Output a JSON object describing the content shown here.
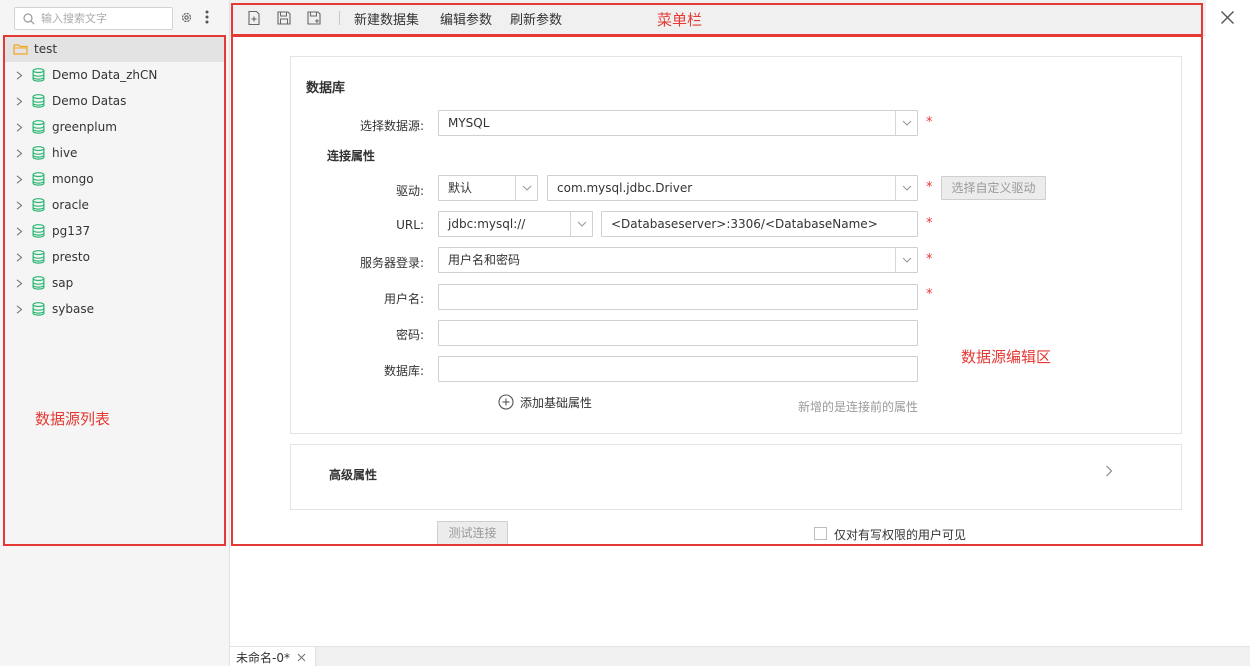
{
  "sidebar": {
    "search_placeholder": "输入搜索文字",
    "root": {
      "label": "test",
      "icon": "folder-icon"
    },
    "items": [
      {
        "label": "Demo Data_zhCN",
        "icon": "database-icon"
      },
      {
        "label": "Demo Datas",
        "icon": "database-icon"
      },
      {
        "label": "greenplum",
        "icon": "database-icon"
      },
      {
        "label": "hive",
        "icon": "database-icon"
      },
      {
        "label": "mongo",
        "icon": "database-icon"
      },
      {
        "label": "oracle",
        "icon": "database-icon"
      },
      {
        "label": "pg137",
        "icon": "database-icon"
      },
      {
        "label": "presto",
        "icon": "database-icon"
      },
      {
        "label": "sap",
        "icon": "database-icon"
      },
      {
        "label": "sybase",
        "icon": "database-icon"
      }
    ]
  },
  "toolbar": {
    "new_dataset": "新建数据集",
    "edit_params": "编辑参数",
    "refresh_params": "刷新参数"
  },
  "annotations": {
    "menu_bar": "菜单栏",
    "datasource_list": "数据源列表",
    "datasource_edit": "数据源编辑区"
  },
  "form": {
    "section_title": "数据库",
    "datasource_label": "选择数据源:",
    "datasource_value": "MYSQL",
    "connection_title": "连接属性",
    "driver_label": "驱动:",
    "driver_mode": "默认",
    "driver_value": "com.mysql.jdbc.Driver",
    "custom_driver_button": "选择自定义驱动",
    "url_label": "URL:",
    "url_prefix": "jdbc:mysql://",
    "url_value": "<Databaseserver>:3306/<DatabaseName>",
    "server_login_label": "服务器登录:",
    "server_login_value": "用户名和密码",
    "username_label": "用户名:",
    "username_value": "",
    "password_label": "密码:",
    "password_value": "",
    "database_label": "数据库:",
    "database_value": "",
    "required_mark": "*",
    "add_basic_attr": "添加基础属性",
    "hint": "新增的是连接前的属性",
    "advanced_title": "高级属性",
    "test_connection": "测试连接",
    "write_permission_only": "仅对有写权限的用户可见"
  },
  "bottom_tabs": [
    {
      "label": "未命名-0*"
    }
  ],
  "colors": {
    "annotation": "#e53935",
    "database_icon": "#2bb673",
    "folder_icon": "#f5a623"
  }
}
